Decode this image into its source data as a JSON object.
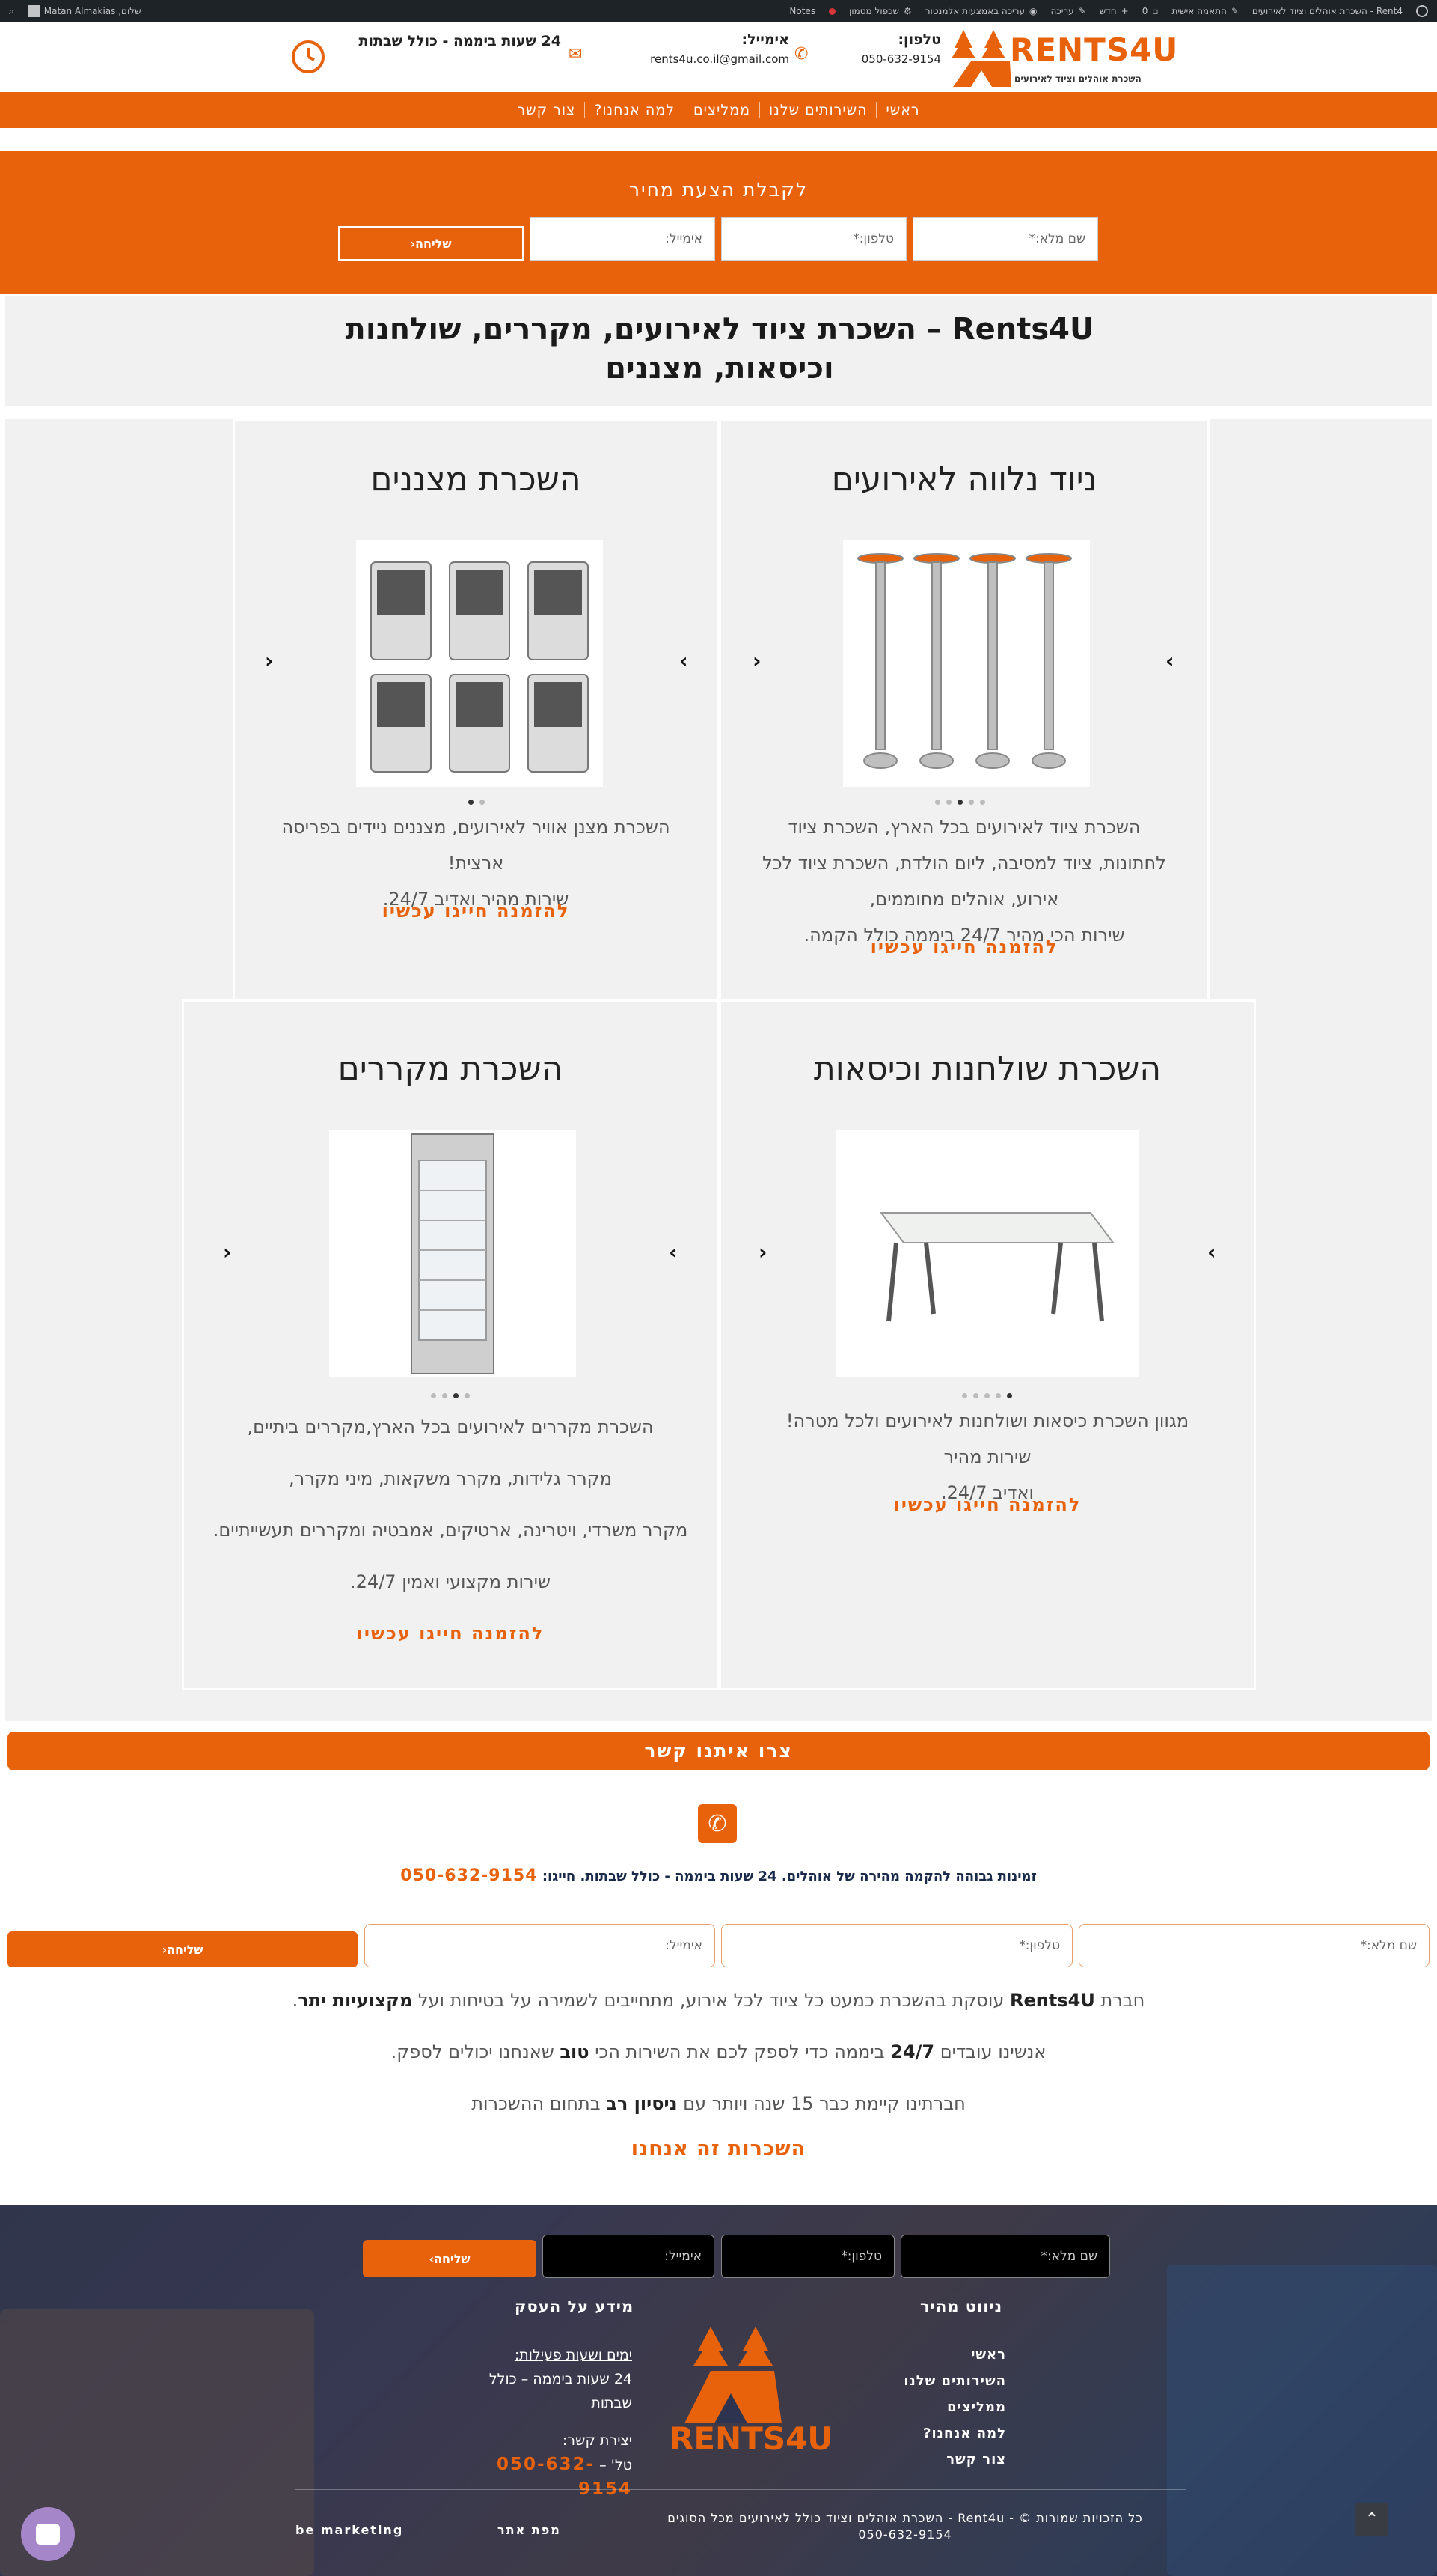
{
  "adminbar": {
    "site": "Rent4 - השכרת אוהלים וציוד לאירועים",
    "customize": "התאמה אישית",
    "comments": "0",
    "new": "חדש",
    "edit": "עריכה",
    "elementor": "עריכה באמצעות אלמנטור",
    "cache": "שכפול מטמון",
    "notes": "Notes",
    "greeting": "שלום, Matan Almakias"
  },
  "header": {
    "brand": "RENTS4U",
    "tagline": "השכרת אוהלים וציוד לאירועים",
    "phone_label": "טלפון:",
    "phone_value": "050-632-9154",
    "email_label": "אימייל:",
    "email_value": "rents4u.co.il@gmail.com",
    "hours": "24 שעות ביממה - כולל שבתות"
  },
  "nav": [
    "ראשי",
    "השירותים שלנו",
    "ממליצים",
    "למה אנחנו?",
    "צור קשר"
  ],
  "quote_form": {
    "title": "לקבלת הצעת מחיר",
    "name_placeholder": "שם מלא:*",
    "phone_placeholder": "טלפון:*",
    "email_placeholder": "אימייל:",
    "send": "שליחה"
  },
  "page_title": "Rents4U  –  השכרת ציוד לאירועים, מקררים, שולחנות וכיסאות, מצננים",
  "services": [
    {
      "title": "ניוד נלווה לאירועים",
      "desc": [
        "השכרת ציוד לאירועים בכל הארץ, השכרת ציוד לחתונות, ציוד למסיבה, ליום הולדת, השכרת ציוד לכל אירוע, אוהלים מחוממים,",
        "שירות הכי מהיר 24/7 ביממה כולל הקמה."
      ],
      "cta": "להזמנה חייגו עכשיו",
      "image": "patio-heaters-image",
      "dots": 5,
      "active_dot": 2
    },
    {
      "title": "השכרת מצננים",
      "desc": [
        "השכרת מצנן אוויר לאירועים, מצננים ניידים בפריסה ארצית!",
        "שירות מהיר ואדיב 24/7."
      ],
      "cta": "להזמנה חייגו עכשיו",
      "image": "air-coolers-image",
      "dots": 2,
      "active_dot": 0
    },
    {
      "title": "השכרת שולחנות וכיסאות",
      "desc": [
        "מגוון השכרת כיסאות ושולחנות לאירועים ולכל מטרה! שירות מהיר",
        "ואדיב 24/7."
      ],
      "cta": "להזמנה חייגו עכשיו",
      "image": "folding-table-image",
      "dots": 5,
      "active_dot": 4
    },
    {
      "title": "השכרת מקררים",
      "desc": [
        "השכרת מקררים לאירועים בכל הארץ,מקררים ביתיים,",
        "מקרר גלידות, מקרר משקאות, מיני מקרר,",
        "מקרר משרדי, ויטרינה, ארטיקים, אמבטיה ומקררים תעשייתיים.",
        "שירות מקצועי ואמין 24/7."
      ],
      "cta": "להזמנה חייגו עכשיו",
      "image": "refrigerator-image",
      "dots": 4,
      "active_dot": 2
    }
  ],
  "contact": {
    "bar": "צרו איתנו קשר",
    "availability": "זמינות גבוהה להקמה מהירה של אוהלים. 24 שעות ביממה - כולל שבתות. חייגו:",
    "phone": "050-632-9154",
    "name_placeholder": "שם מלא:*",
    "phone_placeholder": "טלפון:*",
    "email_placeholder": "אימייל:",
    "send": "שליחה"
  },
  "about": {
    "l1a": "חברת ",
    "l1b": "Rents4U",
    "l1c": " עוסקת בהשכרת כמעט כל ציוד לכל אירוע, מתחייבים לשמירה על בטיחות ועל ",
    "l1d": "מקצועיות יתר",
    "l1e": ".",
    "l2a": "אנשינו עובדים ",
    "l2b": "24/7",
    "l2c": " ביממה כדי לספק לכם את השירות הכי ",
    "l2d": "טוב",
    "l2e": " שאנחנו יכולים לספק.",
    "l3a": "חברתינו קיימת כבר 15 שנה ויותר עם ",
    "l3b": "ניסיון רב",
    "l3c": " בתחום ההשכרות",
    "cta": "השכרות זה אנחנו"
  },
  "footer": {
    "name_placeholder": "שם מלא:*",
    "phone_placeholder": "טלפון:*",
    "email_placeholder": "אימייל:",
    "send": "שליחה",
    "nav_title": "ניווט מהיר",
    "nav": [
      "ראשי",
      "השירותים שלנו",
      "ממליצים",
      "למה אנחנו?",
      "צור קשר"
    ],
    "info_title": "מידע על העסק",
    "hours_label": "ימים ושעות פעילות:",
    "hours_value": "24 שעות ביממה – כולל שבתות",
    "contact_label": "יצירת קשר:",
    "phone_prefix": "טל' – ",
    "phone": "050-632-9154",
    "brand": "RENTS4U",
    "copyright": "כל הזכויות שמורות © - Rent4u - השכרת אוהלים וציוד כולל לאירועים מכל הסוגים",
    "copyright_phone": "050-632-9154",
    "sitemap": "מפת אתר",
    "credit": "be marketing"
  },
  "colors": {
    "accent": "#e8620c",
    "admin": "#1d2327",
    "panel": "#f1f1f1"
  }
}
